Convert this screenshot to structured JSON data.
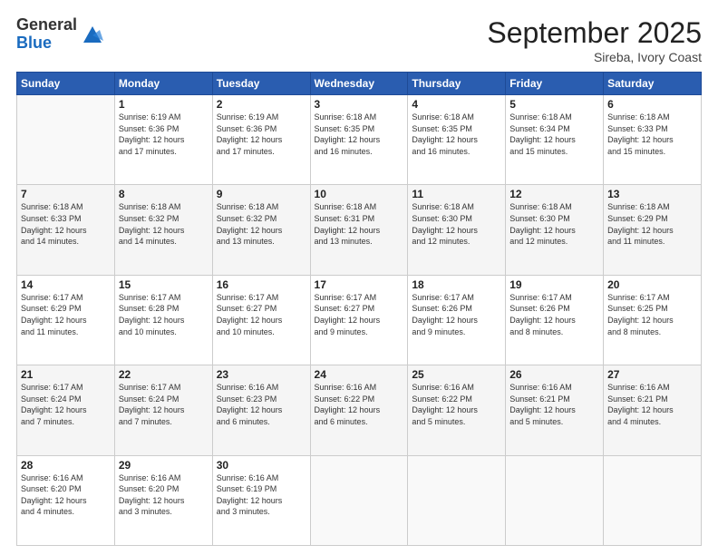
{
  "logo": {
    "general": "General",
    "blue": "Blue"
  },
  "header": {
    "title": "September 2025",
    "location": "Sireba, Ivory Coast"
  },
  "weekdays": [
    "Sunday",
    "Monday",
    "Tuesday",
    "Wednesday",
    "Thursday",
    "Friday",
    "Saturday"
  ],
  "weeks": [
    [
      {
        "day": "",
        "info": ""
      },
      {
        "day": "1",
        "info": "Sunrise: 6:19 AM\nSunset: 6:36 PM\nDaylight: 12 hours\nand 17 minutes."
      },
      {
        "day": "2",
        "info": "Sunrise: 6:19 AM\nSunset: 6:36 PM\nDaylight: 12 hours\nand 17 minutes."
      },
      {
        "day": "3",
        "info": "Sunrise: 6:18 AM\nSunset: 6:35 PM\nDaylight: 12 hours\nand 16 minutes."
      },
      {
        "day": "4",
        "info": "Sunrise: 6:18 AM\nSunset: 6:35 PM\nDaylight: 12 hours\nand 16 minutes."
      },
      {
        "day": "5",
        "info": "Sunrise: 6:18 AM\nSunset: 6:34 PM\nDaylight: 12 hours\nand 15 minutes."
      },
      {
        "day": "6",
        "info": "Sunrise: 6:18 AM\nSunset: 6:33 PM\nDaylight: 12 hours\nand 15 minutes."
      }
    ],
    [
      {
        "day": "7",
        "info": "Sunrise: 6:18 AM\nSunset: 6:33 PM\nDaylight: 12 hours\nand 14 minutes."
      },
      {
        "day": "8",
        "info": "Sunrise: 6:18 AM\nSunset: 6:32 PM\nDaylight: 12 hours\nand 14 minutes."
      },
      {
        "day": "9",
        "info": "Sunrise: 6:18 AM\nSunset: 6:32 PM\nDaylight: 12 hours\nand 13 minutes."
      },
      {
        "day": "10",
        "info": "Sunrise: 6:18 AM\nSunset: 6:31 PM\nDaylight: 12 hours\nand 13 minutes."
      },
      {
        "day": "11",
        "info": "Sunrise: 6:18 AM\nSunset: 6:30 PM\nDaylight: 12 hours\nand 12 minutes."
      },
      {
        "day": "12",
        "info": "Sunrise: 6:18 AM\nSunset: 6:30 PM\nDaylight: 12 hours\nand 12 minutes."
      },
      {
        "day": "13",
        "info": "Sunrise: 6:18 AM\nSunset: 6:29 PM\nDaylight: 12 hours\nand 11 minutes."
      }
    ],
    [
      {
        "day": "14",
        "info": "Sunrise: 6:17 AM\nSunset: 6:29 PM\nDaylight: 12 hours\nand 11 minutes."
      },
      {
        "day": "15",
        "info": "Sunrise: 6:17 AM\nSunset: 6:28 PM\nDaylight: 12 hours\nand 10 minutes."
      },
      {
        "day": "16",
        "info": "Sunrise: 6:17 AM\nSunset: 6:27 PM\nDaylight: 12 hours\nand 10 minutes."
      },
      {
        "day": "17",
        "info": "Sunrise: 6:17 AM\nSunset: 6:27 PM\nDaylight: 12 hours\nand 9 minutes."
      },
      {
        "day": "18",
        "info": "Sunrise: 6:17 AM\nSunset: 6:26 PM\nDaylight: 12 hours\nand 9 minutes."
      },
      {
        "day": "19",
        "info": "Sunrise: 6:17 AM\nSunset: 6:26 PM\nDaylight: 12 hours\nand 8 minutes."
      },
      {
        "day": "20",
        "info": "Sunrise: 6:17 AM\nSunset: 6:25 PM\nDaylight: 12 hours\nand 8 minutes."
      }
    ],
    [
      {
        "day": "21",
        "info": "Sunrise: 6:17 AM\nSunset: 6:24 PM\nDaylight: 12 hours\nand 7 minutes."
      },
      {
        "day": "22",
        "info": "Sunrise: 6:17 AM\nSunset: 6:24 PM\nDaylight: 12 hours\nand 7 minutes."
      },
      {
        "day": "23",
        "info": "Sunrise: 6:16 AM\nSunset: 6:23 PM\nDaylight: 12 hours\nand 6 minutes."
      },
      {
        "day": "24",
        "info": "Sunrise: 6:16 AM\nSunset: 6:22 PM\nDaylight: 12 hours\nand 6 minutes."
      },
      {
        "day": "25",
        "info": "Sunrise: 6:16 AM\nSunset: 6:22 PM\nDaylight: 12 hours\nand 5 minutes."
      },
      {
        "day": "26",
        "info": "Sunrise: 6:16 AM\nSunset: 6:21 PM\nDaylight: 12 hours\nand 5 minutes."
      },
      {
        "day": "27",
        "info": "Sunrise: 6:16 AM\nSunset: 6:21 PM\nDaylight: 12 hours\nand 4 minutes."
      }
    ],
    [
      {
        "day": "28",
        "info": "Sunrise: 6:16 AM\nSunset: 6:20 PM\nDaylight: 12 hours\nand 4 minutes."
      },
      {
        "day": "29",
        "info": "Sunrise: 6:16 AM\nSunset: 6:20 PM\nDaylight: 12 hours\nand 3 minutes."
      },
      {
        "day": "30",
        "info": "Sunrise: 6:16 AM\nSunset: 6:19 PM\nDaylight: 12 hours\nand 3 minutes."
      },
      {
        "day": "",
        "info": ""
      },
      {
        "day": "",
        "info": ""
      },
      {
        "day": "",
        "info": ""
      },
      {
        "day": "",
        "info": ""
      }
    ]
  ]
}
